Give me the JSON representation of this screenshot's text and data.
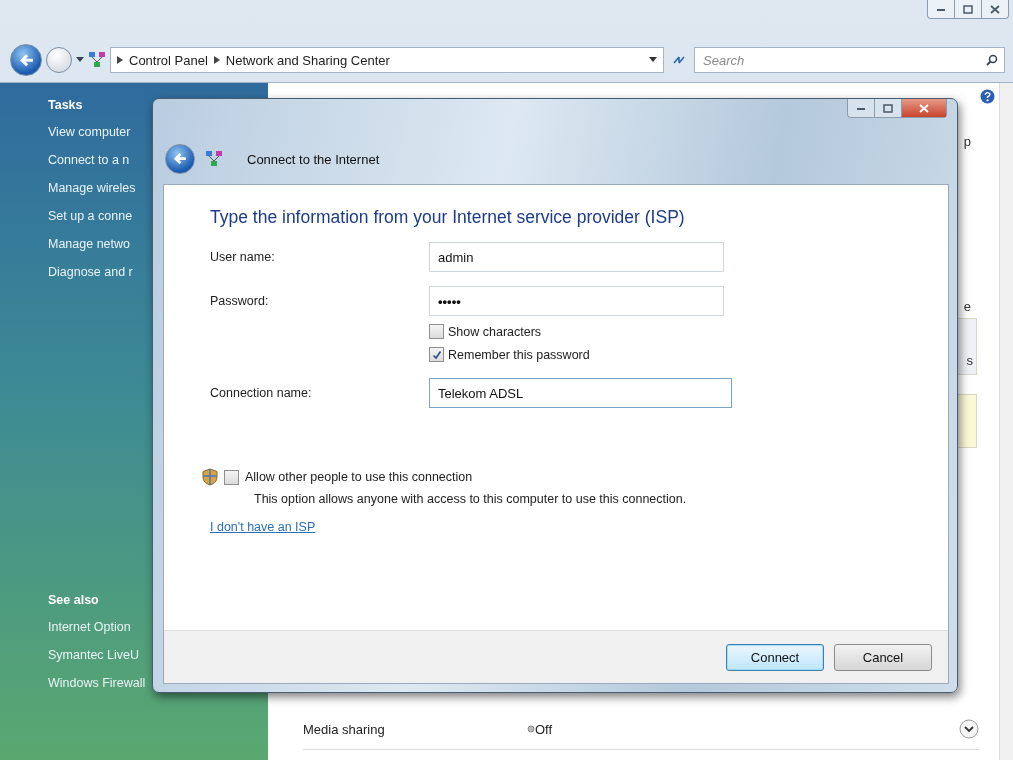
{
  "address_bar": {
    "breadcrumbs": [
      "Control Panel",
      "Network and Sharing Center"
    ],
    "search": {
      "placeholder": "Search"
    }
  },
  "sidebar": {
    "sections": [
      {
        "title": "Tasks",
        "items": [
          "View computer",
          "Connect to a n",
          "Manage wireles",
          "Set up a conne",
          "Manage netwo",
          "Diagnose and r"
        ]
      },
      {
        "title": "See also",
        "items": [
          "Internet Option",
          "Symantec LiveU",
          "Windows Firewall"
        ]
      }
    ]
  },
  "content": {
    "edge_fragments": [
      "p",
      "e",
      "s"
    ],
    "rows": [
      {
        "label": "Media sharing",
        "status": "Off"
      }
    ]
  },
  "dialog": {
    "title": "Connect to the Internet",
    "heading": "Type the information from your Internet service provider (ISP)",
    "fields": [
      {
        "label": "User name:",
        "value": "admin",
        "focused": false
      },
      {
        "label": "Password:",
        "value": "•••••",
        "focused": false,
        "options": [
          {
            "label": "Show characters",
            "checked": false
          },
          {
            "label": "Remember this password",
            "checked": true
          }
        ]
      },
      {
        "label": "Connection name:",
        "value": "Telekom ADSL",
        "focused": true
      }
    ],
    "sharing": {
      "label": "Allow other people to use this connection",
      "checked": false,
      "description": "This option allows anyone with access to this computer to use this connection."
    },
    "link": "I don't have an ISP",
    "buttons": [
      {
        "label": "Connect",
        "default": true
      },
      {
        "label": "Cancel",
        "default": false
      }
    ]
  }
}
